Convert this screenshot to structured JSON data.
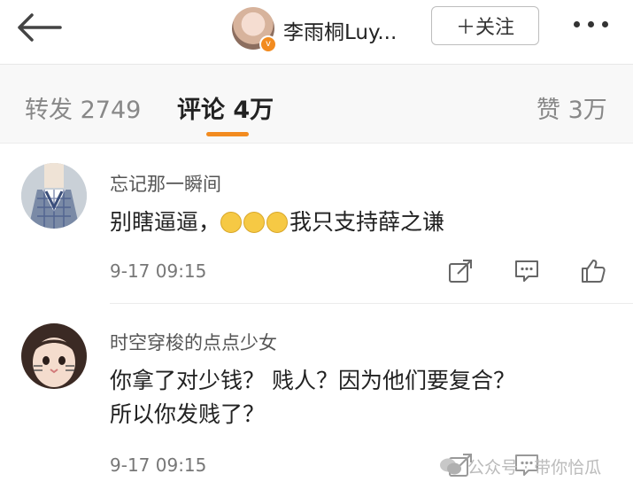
{
  "header": {
    "title": "李雨桐Luy...",
    "follow_label": "＋关注"
  },
  "tabs": [
    {
      "label": "转发 2749"
    },
    {
      "label": "评论 4万"
    },
    {
      "label": "赞 3万"
    }
  ],
  "comments": [
    {
      "username": "忘记那一瞬间",
      "text_before": "别瞎逼逼，",
      "text_after": "我只支持薛之谦",
      "timestamp": "9-17 09:15"
    },
    {
      "username": "时空穿梭的点点少女",
      "text_line1": "你拿了对少钱？ 贱人？因为他们要复合？",
      "text_line2": "所以你发贱了？",
      "timestamp": "9-17 09:15"
    }
  ],
  "watermark": {
    "text": "公众号 · 带你恰瓜"
  },
  "colors": {
    "accent": "#f28b1f",
    "text_primary": "#222222",
    "text_secondary": "#777777"
  }
}
